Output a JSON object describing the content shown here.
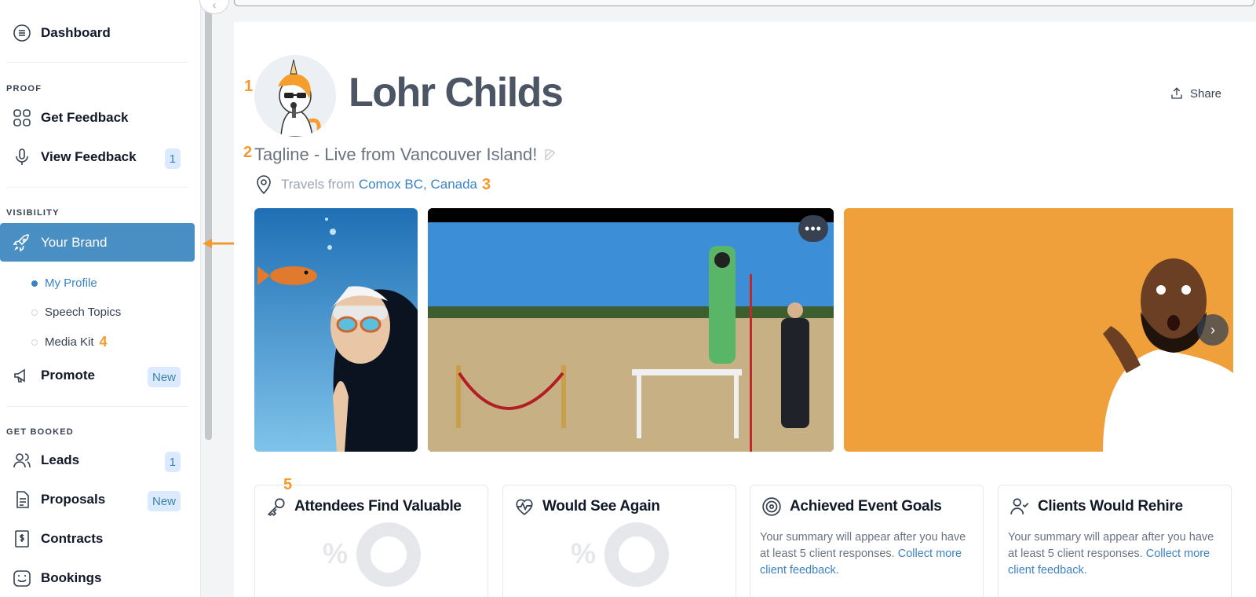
{
  "sidebar": {
    "dashboard": "Dashboard",
    "sections": {
      "proof": "PROOF",
      "visibility": "VISIBILITY",
      "get_booked": "GET BOOKED"
    },
    "get_feedback": "Get Feedback",
    "view_feedback": "View Feedback",
    "view_feedback_badge": "1",
    "your_brand": "Your Brand",
    "sub_items": {
      "my_profile": "My Profile",
      "speech_topics": "Speech Topics",
      "media_kit": "Media Kit"
    },
    "promote": "Promote",
    "promote_badge": "New",
    "leads": "Leads",
    "leads_badge": "1",
    "proposals": "Proposals",
    "proposals_badge": "New",
    "contracts": "Contracts",
    "bookings": "Bookings",
    "accent_color": "#4a8fc3"
  },
  "annotations": {
    "m1": "1",
    "m2": "2",
    "m3": "3",
    "m4": "4",
    "m5": "5"
  },
  "profile": {
    "name": "Lohr Childs",
    "share_label": "Share",
    "tagline": "Tagline - Live from Vancouver Island!",
    "travels_prefix": "Travels from",
    "location": "Comox BC, Canada"
  },
  "media_controls": {
    "more": "•••",
    "next": "›"
  },
  "stats": [
    {
      "title": "Attendees Find Valuable",
      "pct": "%"
    },
    {
      "title": "Would See Again",
      "pct": "%"
    },
    {
      "title": "Achieved Event Goals",
      "summary": "Your summary will appear after you have at least 5 client responses.",
      "link": "Collect more client feedback."
    },
    {
      "title": "Clients Would Rehire",
      "summary": "Your summary will appear after you have at least 5 client responses.",
      "link": "Collect more client feedback."
    }
  ]
}
